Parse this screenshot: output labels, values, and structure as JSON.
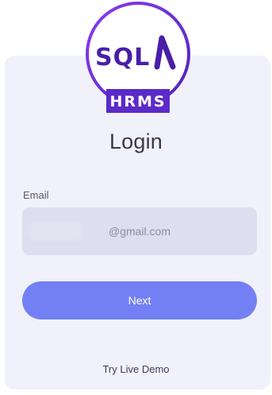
{
  "logo": {
    "mark_text": "SQL",
    "badge_text": "HRMS",
    "colors": {
      "ring": "#6b2fd6",
      "badge": "#5b2ac8",
      "mark": "#4a1fa8"
    }
  },
  "login": {
    "title": "Login",
    "email_label": "Email",
    "email_value": "@gmail.com",
    "next_label": "Next",
    "demo_link": "Try Live Demo"
  },
  "colors": {
    "card": "#f1f1fb",
    "input": "#dddeee",
    "button": "#7380f3"
  }
}
